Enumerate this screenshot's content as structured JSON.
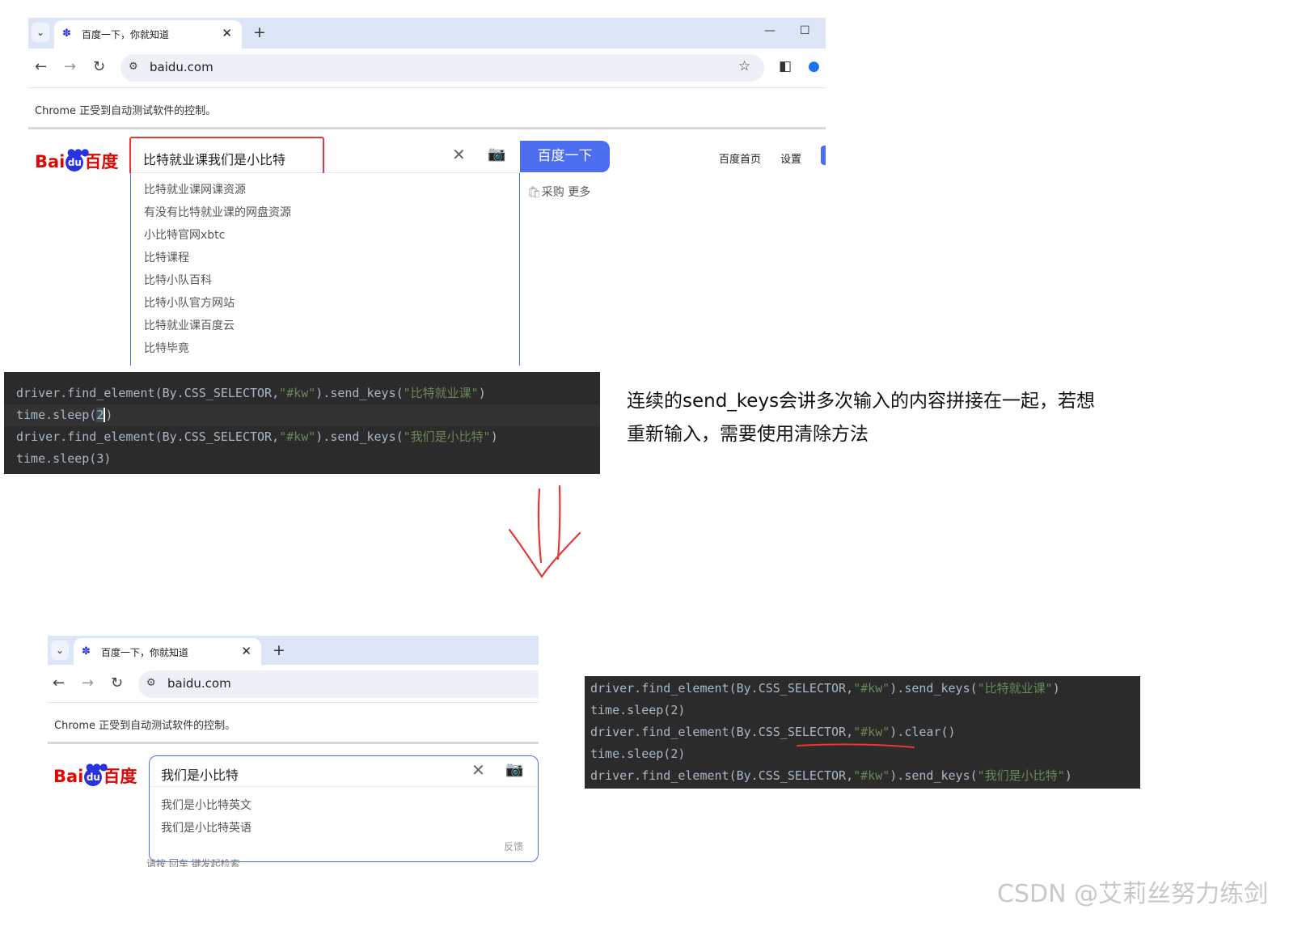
{
  "top_browser": {
    "tab_title": "百度一下，你就知道",
    "url": "baidu.com",
    "infobar": "Chrome 正受到自动测试软件的控制。",
    "search_value": "比特就业课我们是小比特",
    "search_button": "百度一下",
    "links": [
      "百度首页",
      "设置"
    ],
    "sub_links": "采购   更多",
    "suggestions": [
      "比特就业课网课资源",
      "有没有比特就业课的网盘资源",
      "小比特官网xbtc",
      "比特课程",
      "比特小队百科",
      "比特小队官方网站",
      "比特就业课百度云",
      "比特毕竟"
    ]
  },
  "code_top": {
    "l1a": "driver.find_element(By.CSS_SELECTOR,",
    "l1b": "\"#kw\"",
    "l1c": ").send_keys(",
    "l1d": "\"比特就业课\"",
    "l1e": ")",
    "l2a": "time.sleep(",
    "l2b": "2",
    "l2c": ")",
    "l3a": "driver.find_element(By.CSS_SELECTOR,",
    "l3b": "\"#kw\"",
    "l3c": ").send_keys(",
    "l3d": "\"我们是小比特\"",
    "l3e": ")",
    "l4": "time.sleep(3)"
  },
  "annotation": {
    "line1": "连续的send_keys会讲多次输入的内容拼接在一起，若想",
    "line2": "重新输入，需要使用清除方法"
  },
  "bottom_browser": {
    "tab_title": "百度一下，你就知道",
    "url": "baidu.com",
    "infobar": "Chrome 正受到自动测试软件的控制。",
    "search_value": "我们是小比特",
    "suggestions": [
      "我们是小比特英文",
      "我们是小比特英语"
    ],
    "feedback": "反馈",
    "hint": "请按 回车 键发起检索"
  },
  "code_bottom": {
    "l1a": "driver.find_element(By.CSS_SELECTOR,",
    "l1b": "\"#kw\"",
    "l1c": ").send_keys(",
    "l1d": "\"比特就业课\"",
    "l1e": ")",
    "l2": "time.sleep(2)",
    "l3a": "driver.find_element(By.CSS_SELECTOR,",
    "l3b": "\"#kw\"",
    "l3c": ").clear()",
    "l4": "time.sleep(2)",
    "l5a": "driver.find_element(By.CSS_SELECTOR,",
    "l5b": "\"#kw\"",
    "l5c": ").send_keys(",
    "l5d": "\"我们是小比特\"",
    "l5e": ")"
  },
  "watermark": "CSDN @艾莉丝努力练剑",
  "colors": {
    "baidu_red": "#e10602",
    "baidu_blue": "#2932e1",
    "search_button": "#4e6ef2",
    "highlight_box": "#e53935",
    "code_bg": "#2b2b2b",
    "code_string": "#6a8759"
  }
}
